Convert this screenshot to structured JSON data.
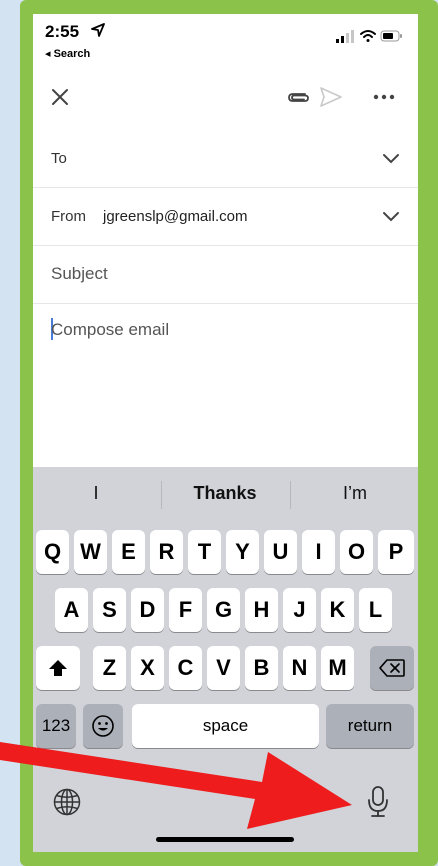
{
  "status_bar": {
    "time": "2:55",
    "back_app": "◂ Search"
  },
  "toolbar": {
    "close_icon": "close-icon",
    "attach_icon": "paperclip-icon",
    "send_icon": "send-icon",
    "more_icon": "more-icon"
  },
  "compose": {
    "to_label": "To",
    "from_label": "From",
    "from_value": "jgreenslp@gmail.com",
    "subject_placeholder": "Subject",
    "body_placeholder": "Compose email"
  },
  "keyboard": {
    "suggestions": [
      "I",
      "Thanks",
      "I’m"
    ],
    "row1": [
      "Q",
      "W",
      "E",
      "R",
      "T",
      "Y",
      "U",
      "I",
      "O",
      "P"
    ],
    "row2": [
      "A",
      "S",
      "D",
      "F",
      "G",
      "H",
      "J",
      "K",
      "L"
    ],
    "row3": [
      "Z",
      "X",
      "C",
      "V",
      "B",
      "N",
      "M"
    ],
    "numbers_label": "123",
    "space_label": "space",
    "return_label": "return"
  },
  "colors": {
    "frame": "#8bc34a",
    "background": "#d3e3f2",
    "arrow": "#ee1c1c",
    "keyboard_bg": "#d1d3d9"
  }
}
